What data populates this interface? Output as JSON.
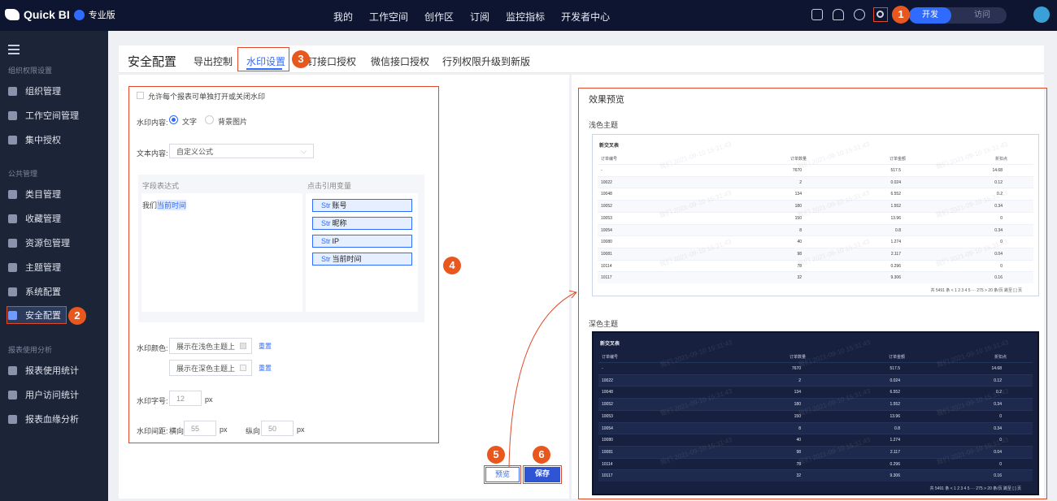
{
  "header": {
    "brand": "Quick BI",
    "edition": "专业版",
    "nav": [
      "我的",
      "工作空间",
      "创作区",
      "订阅",
      "监控指标",
      "开发者中心"
    ],
    "mode_dev": "开发",
    "mode_visit": "访问"
  },
  "sidebar": {
    "sections": [
      "组织权限设置",
      "公共管理",
      "报表使用分析"
    ],
    "items": [
      {
        "label": "组织管理",
        "icon": "users-icon"
      },
      {
        "label": "工作空间管理",
        "icon": "workspace-icon"
      },
      {
        "label": "集中授权",
        "icon": "shield-icon"
      },
      {
        "label": "类目管理",
        "icon": "category-icon"
      },
      {
        "label": "收藏管理",
        "icon": "star-icon"
      },
      {
        "label": "资源包管理",
        "icon": "package-icon"
      },
      {
        "label": "主题管理",
        "icon": "theme-icon"
      },
      {
        "label": "系统配置",
        "icon": "system-icon"
      },
      {
        "label": "安全配置",
        "icon": "security-icon"
      },
      {
        "label": "报表使用统计",
        "icon": "stats-icon"
      },
      {
        "label": "用户访问统计",
        "icon": "user-stats-icon"
      },
      {
        "label": "报表血缘分析",
        "icon": "lineage-icon"
      }
    ]
  },
  "page": {
    "title": "安全配置",
    "tabs": [
      "导出控制",
      "水印设置",
      "钉钉接口授权",
      "微信接口授权",
      "行列权限升级到新版"
    ]
  },
  "form": {
    "allow_toggle": "允许每个报表可单独打开或关闭水印",
    "content_label": "水印内容:",
    "content_text": "文字",
    "content_image": "背景图片",
    "text_label": "文本内容:",
    "text_value": "自定义公式",
    "expr_header": "字段表达式",
    "vars_header": "点击引用变量",
    "expr_prefix": "我们",
    "expr_token": "当前时间",
    "variables": [
      {
        "tag": "Str",
        "name": "账号"
      },
      {
        "tag": "Str",
        "name": "昵称"
      },
      {
        "tag": "Str",
        "name": "IP"
      },
      {
        "tag": "Str",
        "name": "当前时间"
      }
    ],
    "color_label": "水印颜色:",
    "color_light": "展示在浅色主题上",
    "color_dark": "展示在深色主题上",
    "reset": "重置",
    "size_label": "水印字号:",
    "size_value": "12",
    "unit_px": "px",
    "spacing_label": "水印间距:",
    "h_label": "横向",
    "h_value": "55",
    "v_label": "纵向",
    "v_value": "50",
    "preview_btn": "预览",
    "save_btn": "保存"
  },
  "preview": {
    "title": "效果预览",
    "light_label": "浅色主题",
    "dark_label": "深色主题",
    "table_title": "新交叉表",
    "columns": [
      "订单编号",
      "订单数量",
      "订单金额",
      "折扣点"
    ],
    "rows": [
      [
        "-",
        "7670",
        "517.5",
        "14.68"
      ],
      [
        "10022",
        "2",
        "0.024",
        "0.12"
      ],
      [
        "10048",
        "134",
        "6.552",
        "0.2"
      ],
      [
        "10052",
        "180",
        "1.552",
        "0.34"
      ],
      [
        "10053",
        "150",
        "13.96",
        "0"
      ],
      [
        "10054",
        "8",
        "0.8",
        "0.34"
      ],
      [
        "10080",
        "40",
        "1.274",
        "0"
      ],
      [
        "10081",
        "98",
        "2.117",
        "0.04"
      ],
      [
        "10114",
        "78",
        "0.296",
        "0"
      ],
      [
        "10117",
        "32",
        "9.306",
        "0.16"
      ]
    ],
    "pager_total": "共 5491 条",
    "pager_pages": "1  2  3  4  5  ···  275  >",
    "pager_size": "20 条/页",
    "pager_jump": "跳至",
    "pager_page": "页",
    "watermark": "我们 2021-09-10 15:31:43"
  },
  "steps": [
    "1",
    "2",
    "3",
    "4",
    "5",
    "6"
  ],
  "colors": {
    "accent": "#2f6bff",
    "highlight": "#e04a2a",
    "topbar": "#0e1530",
    "sidebar": "#1c2438"
  }
}
